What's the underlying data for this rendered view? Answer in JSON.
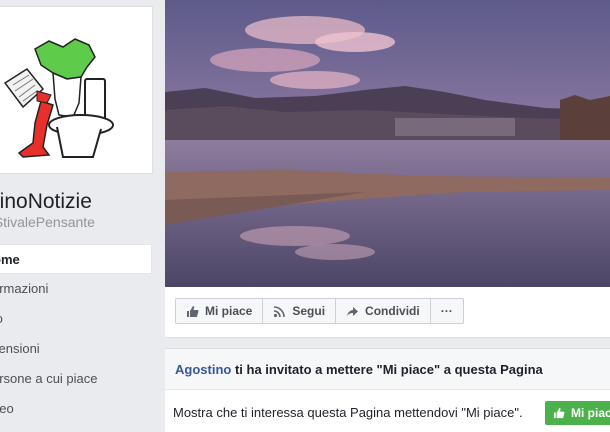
{
  "page": {
    "name": "ainoNotizie",
    "username": "oStivalePensante"
  },
  "nav": {
    "items": [
      {
        "label": "ome",
        "active": true
      },
      {
        "label": "ormazioni",
        "active": false
      },
      {
        "label": "to",
        "active": false
      },
      {
        "label": "censioni",
        "active": false
      },
      {
        "label": "ersone a cui piace",
        "active": false
      },
      {
        "label": "deo",
        "active": false
      }
    ]
  },
  "actions": {
    "like": "Mi piace",
    "follow": "Segui",
    "share": "Condividi",
    "more": "···"
  },
  "invite": {
    "inviter": "Agostino",
    "message": "ti ha invitato a mettere \"Mi piace\" a questa Pagina",
    "body": "Mostra che ti interessa questa Pagina mettendovi \"Mi piace\".",
    "like_button": "Mi piace"
  },
  "colors": {
    "link": "#365899",
    "like_green": "#4bb14b",
    "background": "#e9ebee"
  }
}
